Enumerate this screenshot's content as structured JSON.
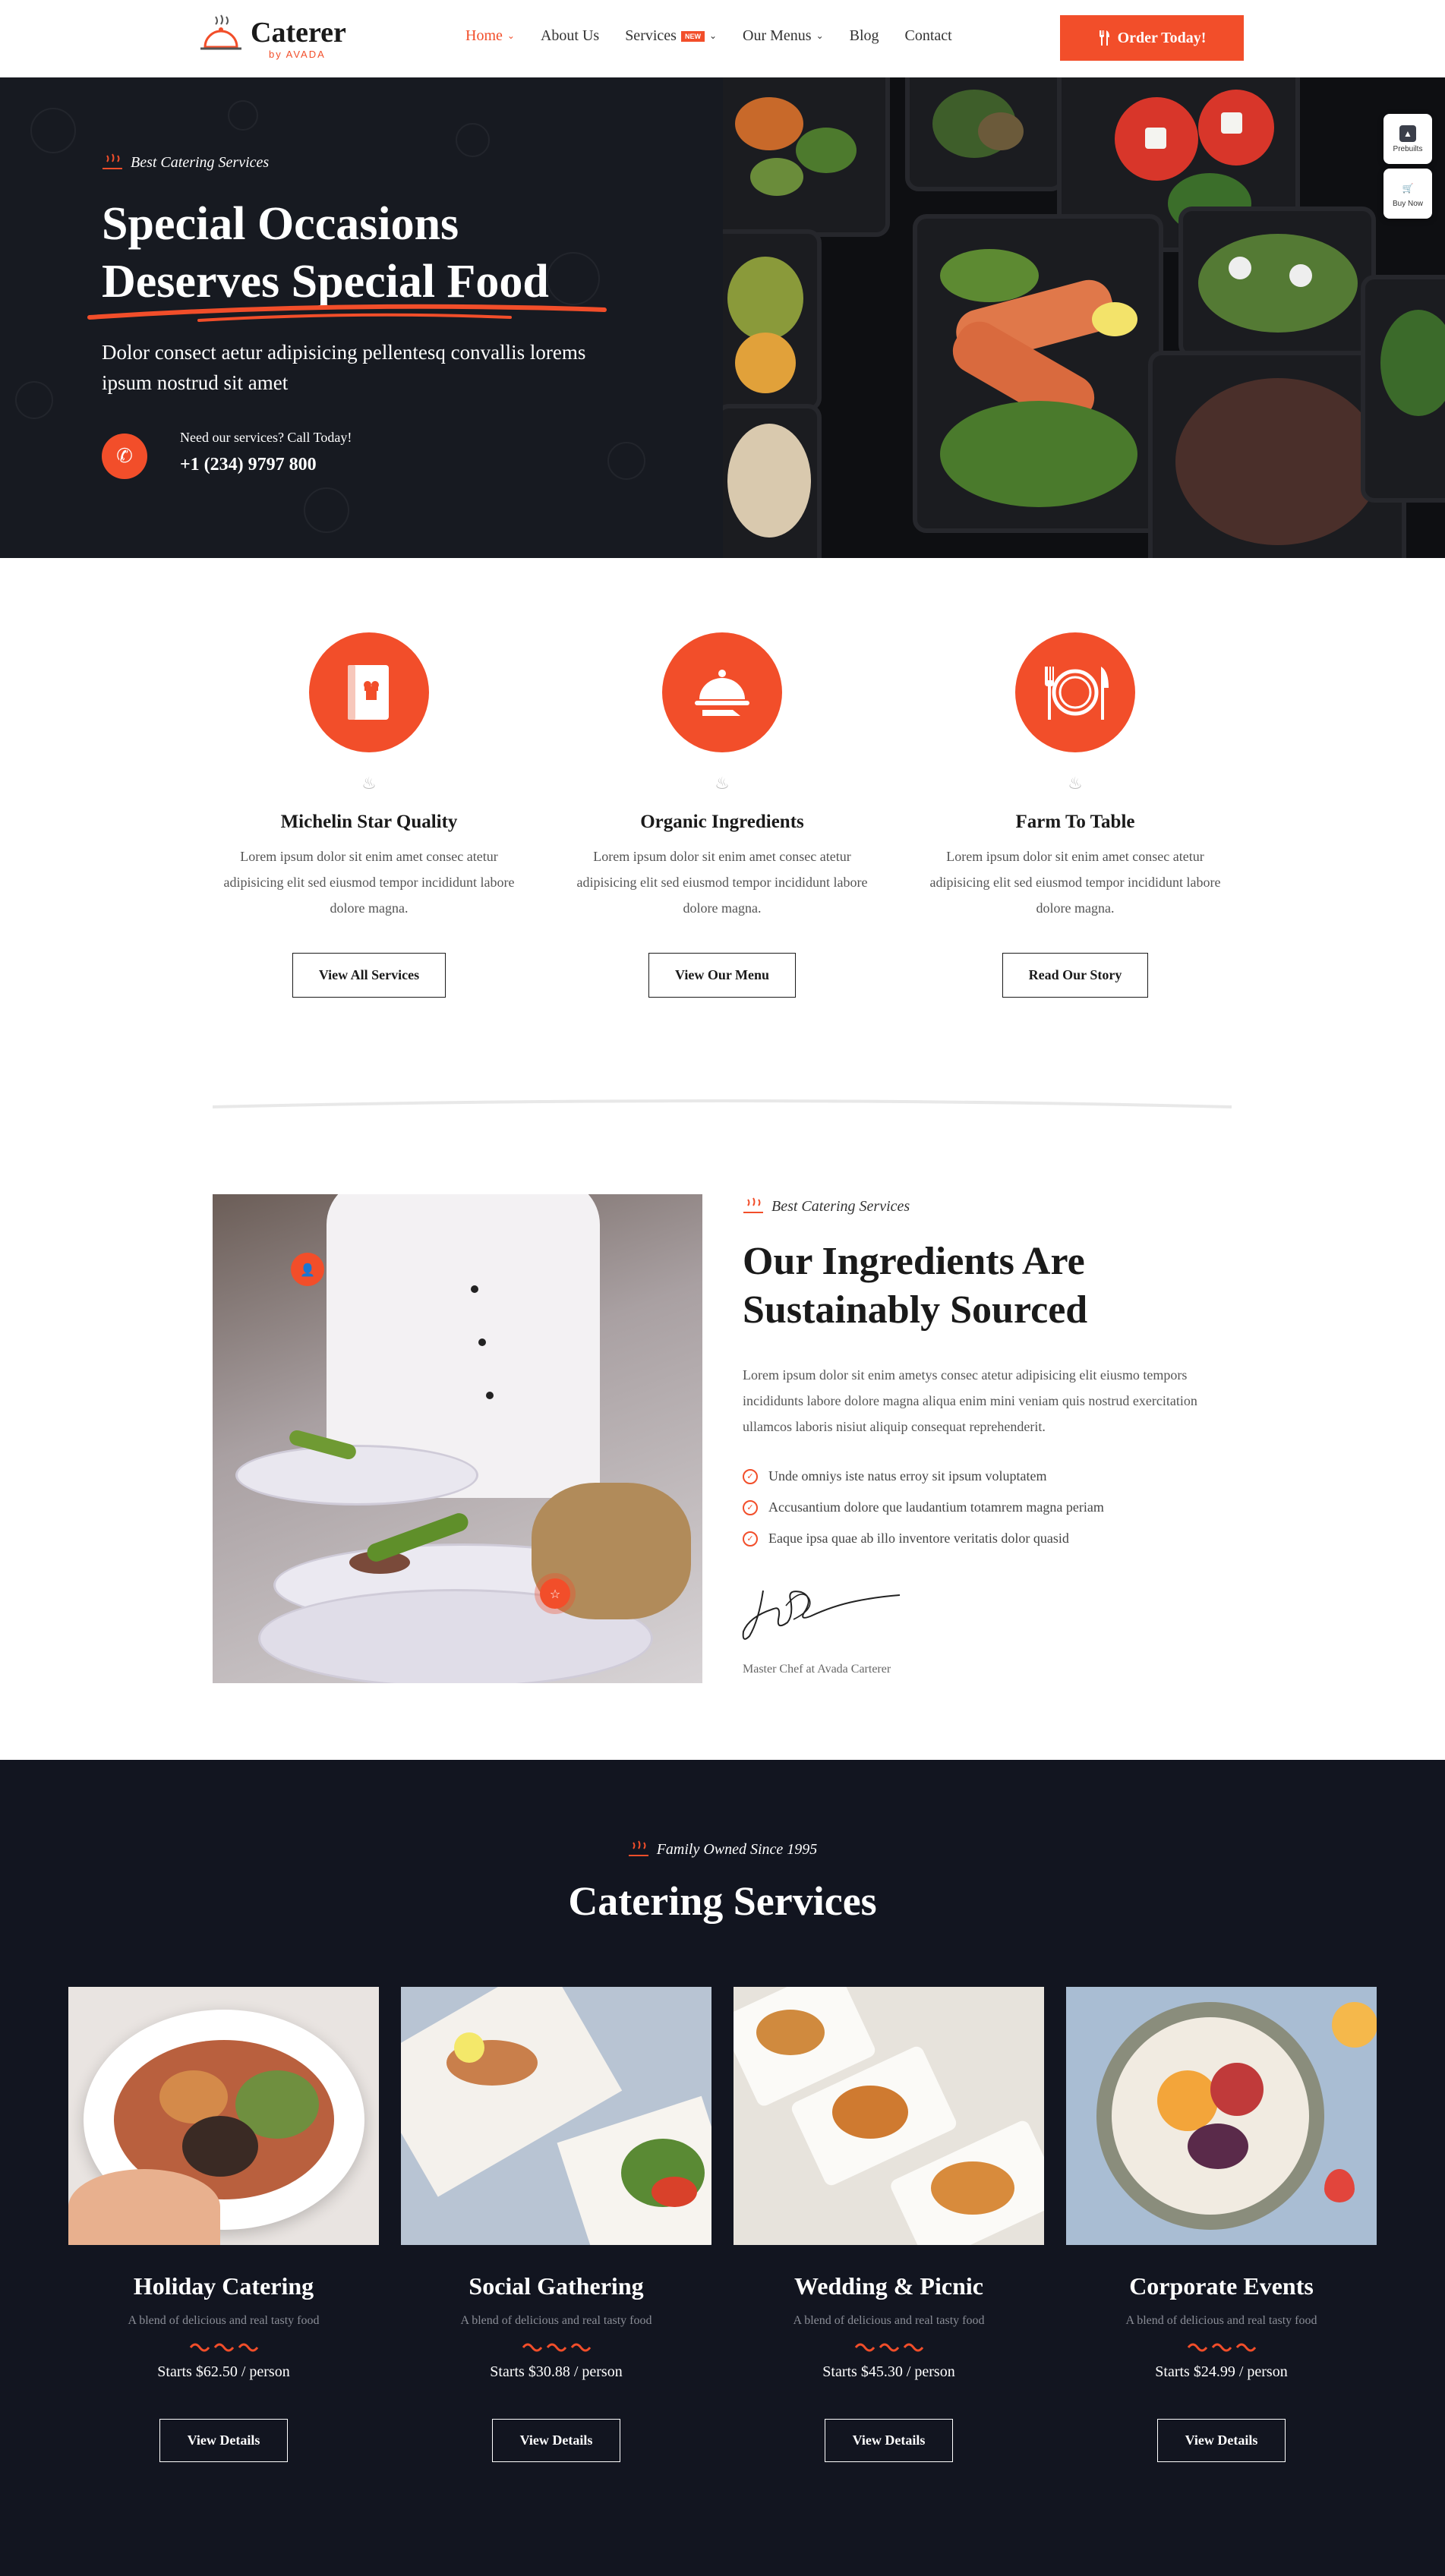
{
  "header": {
    "logo_title": "Caterer",
    "logo_sub": "by AVADA",
    "menu": [
      {
        "label": "Home",
        "active": true,
        "dropdown": true
      },
      {
        "label": "About Us",
        "active": false,
        "dropdown": false
      },
      {
        "label": "Services",
        "active": false,
        "dropdown": true,
        "badge": "NEW"
      },
      {
        "label": "Our Menus",
        "active": false,
        "dropdown": true
      },
      {
        "label": "Blog",
        "active": false,
        "dropdown": false
      },
      {
        "label": "Contact",
        "active": false,
        "dropdown": false
      }
    ],
    "cta_label": "Order Today!"
  },
  "hero": {
    "kicker": "Best Catering Services",
    "title_line1": "Special Occasions",
    "title_line2": "Deserves Special Food",
    "description": "Dolor consect aetur adipisicing pellentesq convallis lorems ipsum nostrud sit amet",
    "call_label": "Need our services? Call Today!",
    "call_number": "+1 (234) 9797 800"
  },
  "side_buttons": {
    "prebuilts": "Prebuilts",
    "buy_now": "Buy Now"
  },
  "features": [
    {
      "icon": "menu-book-icon",
      "title": "Michelin Star Quality",
      "text": "Lorem ipsum dolor sit enim amet consec atetur adipisicing elit sed eiusmod tempor incididunt labore dolore magna.",
      "button": "View All Services"
    },
    {
      "icon": "cloche-icon",
      "title": "Organic Ingredients",
      "text": "Lorem ipsum dolor sit enim amet consec atetur adipisicing elit sed eiusmod tempor incididunt labore dolore magna.",
      "button": "View Our Menu"
    },
    {
      "icon": "plate-cutlery-icon",
      "title": "Farm To Table",
      "text": "Lorem ipsum dolor sit enim amet consec atetur adipisicing elit sed eiusmod tempor incididunt labore dolore magna.",
      "button": "Read Our Story"
    }
  ],
  "about": {
    "kicker": "Best Catering Services",
    "title": "Our Ingredients Are Sustainably Sourced",
    "description": "Lorem ipsum dolor sit enim ametys consec atetur adipisicing elit  eiusmo tempors incididunts labore dolore magna aliqua enim mini veniam quis nostrud exercitation ullamcos laboris nisiut aliquip consequat reprehenderit.",
    "checklist": [
      "Unde omniys iste natus erroy sit ipsum voluptatem",
      "Accusantium dolore que laudantium totamrem magna periam",
      "Eaque ipsa quae ab illo inventore veritatis dolor quasid"
    ],
    "signature_caption": "Master Chef at Avada Carterer"
  },
  "services": {
    "kicker": "Family Owned Since 1995",
    "title": "Catering Services",
    "cards": [
      {
        "title": "Holiday Catering",
        "subtitle": "A blend of delicious and real tasty food",
        "price": "Starts $62.50 / person",
        "button": "View Details"
      },
      {
        "title": "Social Gathering",
        "subtitle": "A blend of delicious and real tasty food",
        "price": "Starts $30.88 / person",
        "button": "View Details"
      },
      {
        "title": "Wedding & Picnic",
        "subtitle": "A blend of delicious and real tasty food",
        "price": "Starts $45.30 / person",
        "button": "View Details"
      },
      {
        "title": "Corporate Events",
        "subtitle": "A blend of delicious and real tasty food",
        "price": "Starts $24.99 / person",
        "button": "View Details"
      }
    ]
  },
  "colors": {
    "accent": "#f24e2a",
    "dark": "#171a21",
    "dark_section": "#121520"
  }
}
